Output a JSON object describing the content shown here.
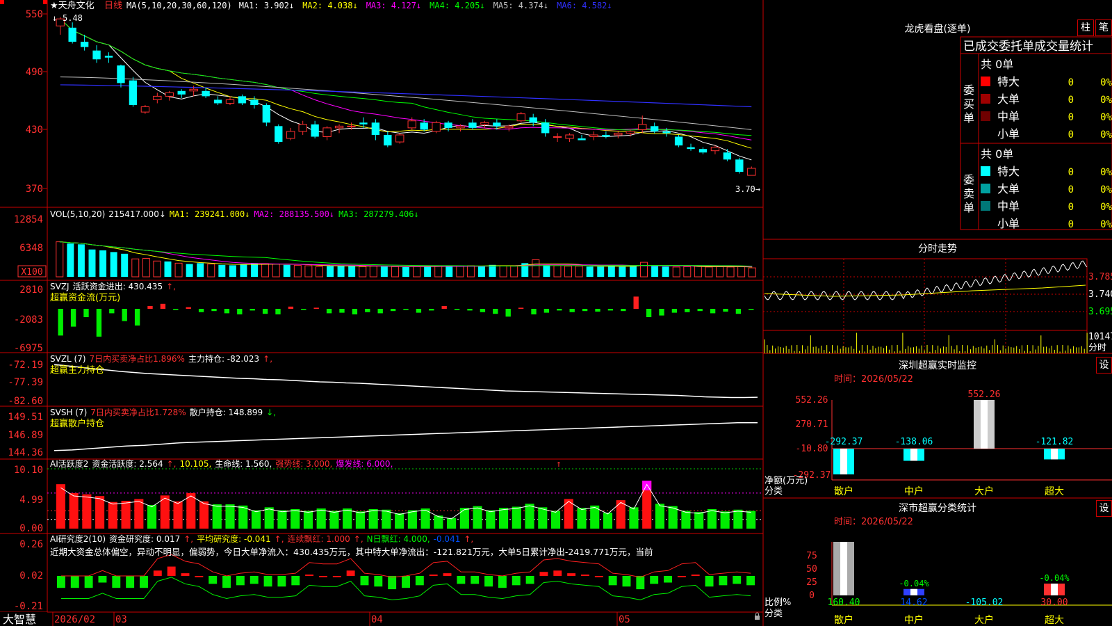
{
  "stock": {
    "name": "天舟文化",
    "period": "日线",
    "star": "★"
  },
  "price_panel": {
    "ma_label": "MA(5,10,20,30,60,120)",
    "ma_items": [
      {
        "label": "MA1:",
        "value": "3.902",
        "arrow": "↓",
        "color": "#ffffff"
      },
      {
        "label": "MA2:",
        "value": "4.038",
        "arrow": "↓",
        "color": "#ffff00"
      },
      {
        "label": "MA3:",
        "value": "4.127",
        "arrow": "↓",
        "color": "#ff00ff"
      },
      {
        "label": "MA4:",
        "value": "4.205",
        "arrow": "↓",
        "color": "#00ff00"
      },
      {
        "label": "MA5:",
        "value": "4.374",
        "arrow": "↓",
        "color": "#c0c0c0"
      },
      {
        "label": "MA6:",
        "value": "4.582",
        "arrow": "↓",
        "color": "#3030ff"
      }
    ],
    "y_ticks": [
      "550",
      "490",
      "430",
      "370"
    ],
    "high_label": "5.48",
    "low_label": "3.70→",
    "high_marker": "↓"
  },
  "vol_panel": {
    "label": "VOL(5,10,20)",
    "value": "215417.000",
    "arrow": "↓",
    "items": [
      {
        "label": "MA1:",
        "value": "239241.000",
        "arrow": "↓",
        "color": "#ffff00"
      },
      {
        "label": "MA2:",
        "value": "288135.500",
        "arrow": "↓",
        "color": "#ff00ff"
      },
      {
        "label": "MA3:",
        "value": "287279.406",
        "arrow": "↓",
        "color": "#00ff00"
      }
    ],
    "y_ticks": [
      "12854",
      "6348"
    ],
    "unit": "X100"
  },
  "svzj_panel": {
    "code": "SVZJ",
    "label": "活跃资金进出:",
    "value": "430.435",
    "arrow": "↑,",
    "subtitle": "超赢资金流(万元)",
    "y_ticks": [
      "2810",
      "-2083",
      "-6975"
    ]
  },
  "svzl_panel": {
    "code": "SVZL (7)",
    "ratio_text": "7日内买卖净占比1.896%",
    "label": "主力持仓:",
    "value": "-82.023",
    "arrow": "↑,",
    "subtitle": "超赢主力持仓",
    "y_ticks": [
      "-72.19",
      "-77.39",
      "-82.60"
    ]
  },
  "svsh_panel": {
    "code": "SVSH (7)",
    "ratio_text": "7日内买卖净占比1.728%",
    "label": "散户持仓:",
    "value": "148.899",
    "arrow": "↓,",
    "subtitle": "超赢散户持仓",
    "y_ticks": [
      "149.51",
      "146.89",
      "144.36"
    ]
  },
  "ai_active_panel": {
    "label": "AI活跃度2",
    "items": [
      {
        "text": "资金活跃度: 2.564",
        "color": "#ffffff"
      },
      {
        "text": "↑,",
        "color": "#ff3030"
      },
      {
        "text": "10.105,",
        "color": "#ffff00"
      },
      {
        "text": "生命线: 1.560,",
        "color": "#ffffff"
      },
      {
        "text": "强势线: 3.000,",
        "color": "#ff3030"
      },
      {
        "text": "爆发线: 6.000,",
        "color": "#ff00ff"
      }
    ],
    "marker": "↑",
    "y_ticks": [
      "10.10",
      "4.99",
      "0.00"
    ]
  },
  "ai_research_panel": {
    "label": "AI研究度2(10)",
    "items": [
      {
        "text": "资金研究度: 0.017",
        "color": "#ffffff"
      },
      {
        "text": "↑,",
        "color": "#ff3030"
      },
      {
        "text": "平均研究度: -0.041",
        "color": "#ffff00"
      },
      {
        "text": "↑,",
        "color": "#ff3030"
      },
      {
        "text": "连续飘红: 1.000",
        "color": "#ff3030"
      },
      {
        "text": "↑,",
        "color": "#ff3030"
      },
      {
        "text": "N日飘红: 4.000,",
        "color": "#00ff00"
      },
      {
        "text": "-0.041",
        "color": "#0050ff"
      },
      {
        "text": "↑,",
        "color": "#ff3030"
      }
    ],
    "comment": "近期大资金总体偏空，异动不明显，偏弱势，今日大单净流入：430.435万元，其中特大单净流出：-121.821万元，大单5日累计净出-2419.771万元，当前",
    "y_ticks": [
      "0.26",
      "0.02",
      "-0.21"
    ]
  },
  "x_axis": {
    "logo": "大智慧",
    "labels": [
      "2026/02",
      "03",
      "04",
      "05"
    ],
    "lock_icon": "lock-icon"
  },
  "longhu": {
    "title": "龙虎看盘(逐单)",
    "btn1": "柱",
    "btn2": "笔",
    "section_title": "已成交委托单成交量统计",
    "buy": {
      "side": "委买单",
      "total": "共 0单",
      "rows": [
        {
          "name": "特大",
          "count": "0",
          "pct": "0%",
          "color": "#ff0000"
        },
        {
          "name": "大单",
          "count": "0",
          "pct": "0%",
          "color": "#a00000"
        },
        {
          "name": "中单",
          "count": "0",
          "pct": "0%",
          "color": "#700000"
        },
        {
          "name": "小单",
          "count": "0",
          "pct": "0%",
          "color": ""
        }
      ]
    },
    "sell": {
      "side": "委卖单",
      "total": "共 0单",
      "rows": [
        {
          "name": "特大",
          "count": "0",
          "pct": "0%",
          "color": "#00ffff"
        },
        {
          "name": "大单",
          "count": "0",
          "pct": "0%",
          "color": "#00a0a0"
        },
        {
          "name": "中单",
          "count": "0",
          "pct": "0%",
          "color": "#007878"
        },
        {
          "name": "小单",
          "count": "0",
          "pct": "0%",
          "color": ""
        }
      ]
    }
  },
  "intraday": {
    "title": "分时走势",
    "prices": [
      "3.785",
      "3.740",
      "3.695"
    ],
    "volume": "10147",
    "unit": "分时"
  },
  "sz_monitor": {
    "title": "深圳超赢实时监控",
    "gear": "设",
    "date_label": "时间：",
    "date": "2026/05/22",
    "y_ticks": [
      "552.26",
      "270.71",
      "-10.80",
      "-292.37"
    ],
    "ylabel": "净额(万元)",
    "xlabel": "分类",
    "cats": [
      "散户",
      "中户",
      "大户",
      "超大"
    ],
    "values": [
      "-292.37",
      "-138.06",
      "552.26",
      "-121.82"
    ]
  },
  "sz_classify": {
    "title": "深市超赢分类统计",
    "gear": "设",
    "date_label": "时间：",
    "date": "2026/05/22",
    "y_ticks": [
      "75",
      "50",
      "25",
      "0"
    ],
    "ylabel": "比例%",
    "xlabel": "分类",
    "cats": [
      "散户",
      "中户",
      "大户",
      "超大"
    ],
    "values": [
      "160.40",
      "14.62",
      "-105.02",
      "30.00"
    ],
    "pct_labels": [
      "",
      "-0.04%",
      "",
      "-0.04%"
    ]
  },
  "chart_data": [
    {
      "type": "candlestick",
      "name": "天舟文化 日线",
      "ylabel": "price",
      "ylim": [
        3.4,
        5.6
      ],
      "x_labels": [
        "2026/02",
        "03",
        "04",
        "05"
      ],
      "ohlc": [
        [
          5.4,
          5.5,
          5.3,
          5.48
        ],
        [
          5.38,
          5.44,
          5.2,
          5.22
        ],
        [
          5.22,
          5.3,
          5.12,
          5.16
        ],
        [
          5.12,
          5.18,
          4.98,
          5.02
        ],
        [
          5.06,
          5.1,
          4.98,
          5.04
        ],
        [
          4.95,
          4.96,
          4.7,
          4.75
        ],
        [
          4.78,
          4.82,
          4.48,
          4.5
        ],
        [
          4.42,
          4.5,
          4.4,
          4.48
        ],
        [
          4.56,
          4.64,
          4.52,
          4.6
        ],
        [
          4.6,
          4.66,
          4.55,
          4.64
        ],
        [
          4.66,
          4.68,
          4.58,
          4.62
        ],
        [
          4.66,
          4.72,
          4.6,
          4.68
        ],
        [
          4.66,
          4.7,
          4.58,
          4.6
        ],
        [
          4.56,
          4.6,
          4.5,
          4.52
        ],
        [
          4.52,
          4.6,
          4.5,
          4.56
        ],
        [
          4.6,
          4.62,
          4.5,
          4.52
        ],
        [
          4.56,
          4.6,
          4.46,
          4.5
        ],
        [
          4.5,
          4.52,
          4.26,
          4.3
        ],
        [
          4.26,
          4.28,
          4.06,
          4.08
        ],
        [
          4.12,
          4.24,
          4.1,
          4.2
        ],
        [
          4.2,
          4.32,
          4.16,
          4.28
        ],
        [
          4.28,
          4.32,
          4.12,
          4.14
        ],
        [
          4.14,
          4.26,
          4.1,
          4.24
        ],
        [
          4.24,
          4.28,
          4.18,
          4.26
        ],
        [
          4.26,
          4.3,
          4.22,
          4.26
        ],
        [
          4.3,
          4.36,
          4.24,
          4.28
        ],
        [
          4.3,
          4.34,
          4.1,
          4.16
        ],
        [
          4.16,
          4.2,
          4.02,
          4.04
        ],
        [
          4.08,
          4.18,
          4.06,
          4.16
        ],
        [
          4.24,
          4.36,
          4.22,
          4.32
        ],
        [
          4.3,
          4.34,
          4.2,
          4.22
        ],
        [
          4.2,
          4.32,
          4.18,
          4.3
        ],
        [
          4.3,
          4.32,
          4.2,
          4.24
        ],
        [
          4.24,
          4.28,
          4.2,
          4.26
        ],
        [
          4.3,
          4.34,
          4.22,
          4.24
        ],
        [
          4.28,
          4.32,
          4.24,
          4.3
        ],
        [
          4.3,
          4.34,
          4.22,
          4.26
        ],
        [
          4.24,
          4.28,
          4.2,
          4.26
        ],
        [
          4.32,
          4.42,
          4.3,
          4.4
        ],
        [
          4.36,
          4.4,
          4.26,
          4.3
        ],
        [
          4.3,
          4.34,
          4.14,
          4.18
        ],
        [
          4.14,
          4.18,
          4.08,
          4.14
        ],
        [
          4.12,
          4.18,
          4.08,
          4.16
        ],
        [
          4.12,
          4.16,
          4.1,
          4.1
        ],
        [
          4.14,
          4.2,
          4.1,
          4.16
        ],
        [
          4.16,
          4.2,
          4.12,
          4.14
        ],
        [
          4.16,
          4.2,
          4.12,
          4.18
        ],
        [
          4.18,
          4.22,
          4.14,
          4.2
        ],
        [
          4.22,
          4.38,
          4.18,
          4.28
        ],
        [
          4.26,
          4.3,
          4.18,
          4.2
        ],
        [
          4.2,
          4.24,
          4.14,
          4.18
        ],
        [
          4.14,
          4.16,
          4.02,
          4.04
        ],
        [
          4.02,
          4.06,
          3.98,
          4.0
        ],
        [
          4.0,
          4.02,
          3.94,
          3.96
        ],
        [
          3.98,
          4.04,
          3.94,
          4.02
        ],
        [
          3.96,
          4.0,
          3.86,
          3.88
        ],
        [
          3.88,
          3.9,
          3.72,
          3.74
        ],
        [
          3.7,
          3.8,
          3.7,
          3.78
        ]
      ]
    },
    {
      "type": "bar",
      "name": "VOL",
      "ylim": [
        0,
        14000
      ],
      "ylabel": "X100",
      "values": [
        8200,
        7800,
        7600,
        6400,
        6200,
        5800,
        5400,
        4200,
        4300,
        3700,
        3600,
        3200,
        3000,
        3200,
        3000,
        2800,
        2700,
        2900,
        3200,
        3100,
        3000,
        2800,
        2700,
        2600,
        2400,
        2500,
        2600,
        2600,
        2400,
        2500,
        2400,
        2400,
        2300,
        2400,
        2500,
        2500,
        2600,
        2500,
        2600,
        2500,
        2800,
        2600,
        2500,
        3200,
        4000,
        2800,
        2600,
        2500,
        2500,
        2400,
        2400,
        2600,
        2400,
        2500,
        3400,
        2500,
        2400,
        2300,
        2400,
        2500,
        2300,
        2400,
        2300,
        2400,
        2100
      ]
    },
    {
      "type": "bar",
      "name": "SVZJ",
      "ylim": [
        -7000,
        3000
      ],
      "values": [
        -4800,
        -3200,
        -1500,
        -5000,
        -800,
        -2200,
        -3000,
        500,
        900,
        -200,
        300,
        -600,
        -400,
        -800,
        -1000,
        -300,
        -900,
        -1000,
        400,
        -200,
        200,
        -800,
        -700,
        -1000,
        -600,
        -800,
        -400,
        -200,
        -700,
        -300,
        500,
        -200,
        -300,
        -600,
        -900,
        -1400,
        200,
        -1000,
        -700,
        -300,
        -600,
        -400,
        -500,
        -300,
        -400,
        2200,
        -1500,
        -1200,
        -700,
        -600,
        -400,
        -800,
        -500,
        -900,
        -200
      ]
    },
    {
      "type": "line",
      "name": "SVZL",
      "ylim": [
        -82.6,
        -72.19
      ],
      "values": [
        -72.6,
        -73.0,
        -73.4,
        -73.9,
        -74.2,
        -74.6,
        -74.9,
        -75.2,
        -75.4,
        -75.6,
        -75.8,
        -76.0,
        -76.2,
        -76.4,
        -76.6,
        -76.7,
        -76.9,
        -77.0,
        -77.2,
        -77.4,
        -77.6,
        -77.7,
        -77.9,
        -78.0,
        -78.2,
        -78.4,
        -78.6,
        -78.8,
        -79.0,
        -79.2,
        -79.4,
        -79.6,
        -79.8,
        -80.0,
        -80.2,
        -80.3,
        -80.4,
        -80.5,
        -80.6,
        -80.7,
        -80.8,
        -80.9,
        -81.0,
        -81.1,
        -81.2,
        -81.3,
        -81.4,
        -81.5,
        -81.7,
        -81.9,
        -82.0,
        -82.1,
        -82.1,
        -82.02
      ]
    },
    {
      "type": "line",
      "name": "SVSH",
      "ylim": [
        144.36,
        149.51
      ],
      "values": [
        144.6,
        144.7,
        144.9,
        145.1,
        145.3,
        145.4,
        145.6,
        145.8,
        145.9,
        146.0,
        146.1,
        146.2,
        146.3,
        146.4,
        146.5,
        146.6,
        146.7,
        146.8,
        146.9,
        147.0,
        147.1,
        147.2,
        147.3,
        147.4,
        147.5,
        147.6,
        147.7,
        147.8,
        147.9,
        148.0,
        148.1,
        148.2,
        148.3,
        148.4,
        148.5,
        148.6,
        148.7,
        148.8,
        148.9,
        148.899
      ]
    },
    {
      "type": "bar",
      "name": "AI活跃度2",
      "ylim": [
        0,
        10.1
      ],
      "values": [
        7.5,
        6.0,
        5.8,
        5.5,
        4.5,
        4.7,
        5.0,
        4.0,
        5.6,
        4.6,
        6.0,
        4.6,
        4.1,
        4.1,
        3.9,
        3.1,
        3.6,
        3.1,
        3.3,
        3.0,
        3.4,
        3.0,
        3.4,
        2.9,
        3.3,
        3.2,
        2.6,
        3.1,
        3.4,
        2.2,
        1.8,
        3.5,
        3.8,
        3.1,
        3.5,
        3.7,
        4.2,
        3.6,
        3.0,
        5.0,
        3.5,
        3.9,
        2.7,
        4.8,
        3.6,
        8.1,
        4.2,
        3.8,
        3.0,
        2.8,
        3.3,
        2.9,
        3.2,
        3.0
      ]
    },
    {
      "type": "bar",
      "name": "AI研究度2",
      "ylim": [
        -0.21,
        0.26
      ],
      "values": [
        -0.07,
        -0.07,
        -0.07,
        -0.03,
        -0.07,
        -0.07,
        -0.07,
        0.06,
        0.09,
        0.04,
        0.02,
        -0.04,
        -0.07,
        -0.05,
        -0.04,
        -0.06,
        -0.06,
        -0.05,
        0.03,
        0.02,
        0.02,
        0.06,
        -0.05,
        -0.06,
        -0.08,
        -0.07,
        -0.05,
        0.03,
        0.04,
        -0.04,
        -0.04,
        -0.06,
        -0.07,
        -0.05,
        -0.04,
        0.05,
        0.06,
        0.04,
        0.03,
        0.02,
        -0.05,
        -0.06,
        -0.08,
        -0.04,
        -0.03,
        0.02,
        0.03,
        -0.06,
        -0.05,
        -0.04,
        -0.05
      ]
    }
  ]
}
